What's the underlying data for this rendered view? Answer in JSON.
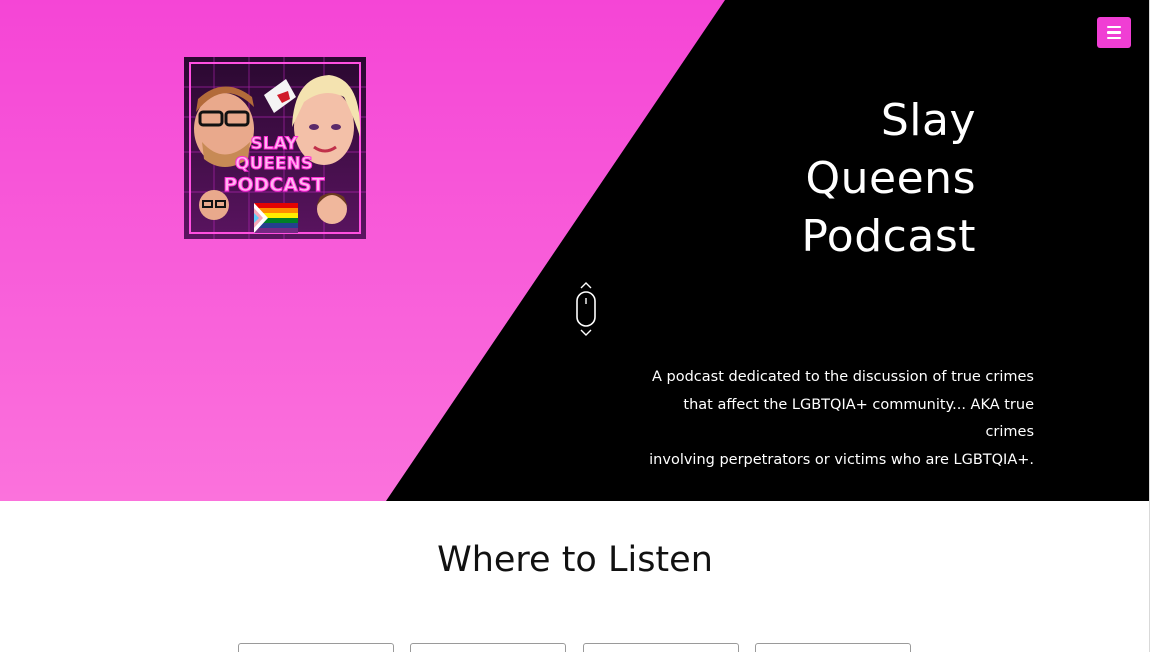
{
  "header": {
    "menu_icon": "hamburger-icon",
    "menu_color": "#f03ed4"
  },
  "hero": {
    "title_lines": [
      "Slay",
      "Queens",
      "Podcast"
    ],
    "description_lines": [
      "A podcast dedicated to the discussion of true crimes",
      "that affect the LGBTQIA+ community... AKA true crimes",
      "involving perpetrators or victims who are LGBTQIA+."
    ],
    "cover": {
      "text_lines": [
        "SLAY",
        "QUEENS",
        "PODCAST"
      ],
      "icon": "podcast-cover-art"
    },
    "scroll_icon": "mouse-scroll-icon",
    "colors": {
      "pink_top": "#f545d6",
      "pink_bottom": "#fb72dc",
      "dark": "#000000"
    }
  },
  "listen": {
    "title": "Where to Listen",
    "platform_count_visible": 4
  }
}
